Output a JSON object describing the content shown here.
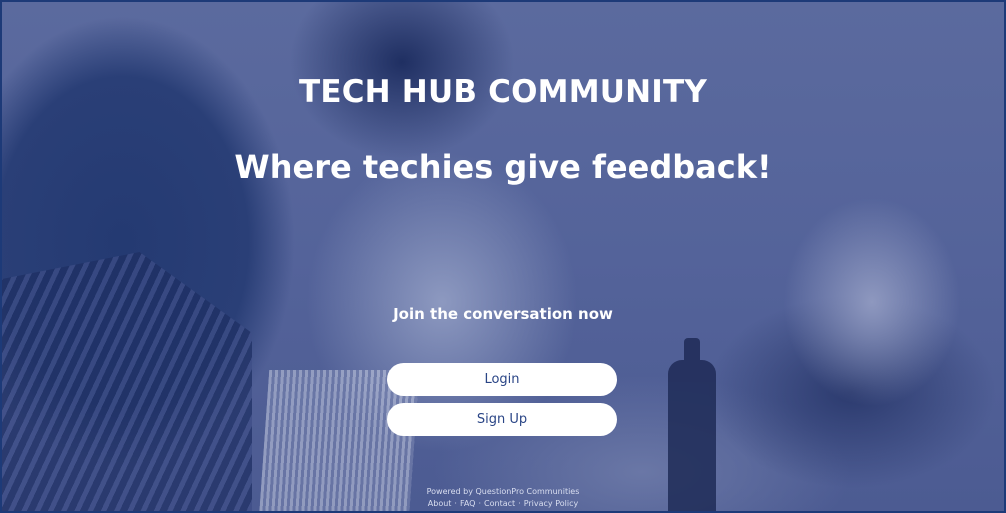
{
  "header": {
    "title": "TECH HUB COMMUNITY",
    "tagline": "Where techies give feedback!"
  },
  "cta": {
    "prompt": "Join the conversation now",
    "login_label": "Login",
    "signup_label": "Sign Up"
  },
  "footer": {
    "powered_by": "Powered by QuestionPro Communities",
    "links": [
      "About",
      "FAQ",
      "Contact",
      "Privacy Policy"
    ],
    "separator": "·"
  },
  "colors": {
    "overlay": "#4f5f93",
    "border": "#1d3a78",
    "button_bg": "#ffffff",
    "button_text": "#2a4586",
    "text": "#ffffff"
  }
}
